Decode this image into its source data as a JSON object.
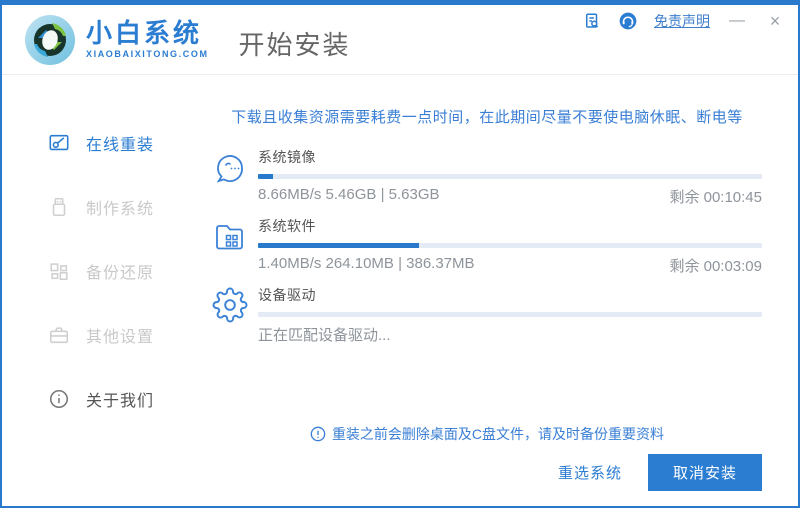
{
  "titlebar": {
    "disclaimer_link": "免责声明",
    "minimize_label": "—",
    "close_label": "×",
    "icons": [
      "document-log-icon",
      "support-headset-icon"
    ]
  },
  "header": {
    "logo_title": "小白系统",
    "logo_subtitle": "XIAOBAIXITONG.COM",
    "page_title": "开始安装"
  },
  "sidebar": {
    "items": [
      {
        "label": "在线重装",
        "icon": "monitor-reinstall-icon",
        "active": true
      },
      {
        "label": "制作系统",
        "icon": "usb-drive-icon",
        "active": false
      },
      {
        "label": "备份还原",
        "icon": "backup-blocks-icon",
        "active": false
      },
      {
        "label": "其他设置",
        "icon": "toolbox-icon",
        "active": false
      },
      {
        "label": "关于我们",
        "icon": "info-circle-icon",
        "active": false
      }
    ]
  },
  "main": {
    "warning": "下载且收集资源需要耗费一点时间，在此期间尽量不要使电脑休眠、断电等",
    "tasks": [
      {
        "title": "系统镜像",
        "icon": "mascot-face-icon",
        "progress_percent": 3,
        "stats": "8.66MB/s 5.46GB | 5.63GB",
        "remaining": "剩余 00:10:45"
      },
      {
        "title": "系统软件",
        "icon": "folder-apps-icon",
        "progress_percent": 32,
        "stats": "1.40MB/s 264.10MB | 386.37MB",
        "remaining": "剩余 00:03:09"
      },
      {
        "title": "设备驱动",
        "icon": "gear-icon",
        "progress_percent": 0,
        "stats": "正在匹配设备驱动...",
        "remaining": ""
      }
    ],
    "notice": "重装之前会删除桌面及C盘文件，请及时备份重要资料",
    "buttons": {
      "reselect": "重选系统",
      "cancel": "取消安装"
    }
  },
  "colors": {
    "accent_blue": "#2b7dd2",
    "progress_fill": "#2878cc",
    "progress_track": "#e4ebf5",
    "warning_text": "#3a7fd5",
    "inactive_gray": "#c9c9c9",
    "meta_gray": "#8e949b"
  }
}
